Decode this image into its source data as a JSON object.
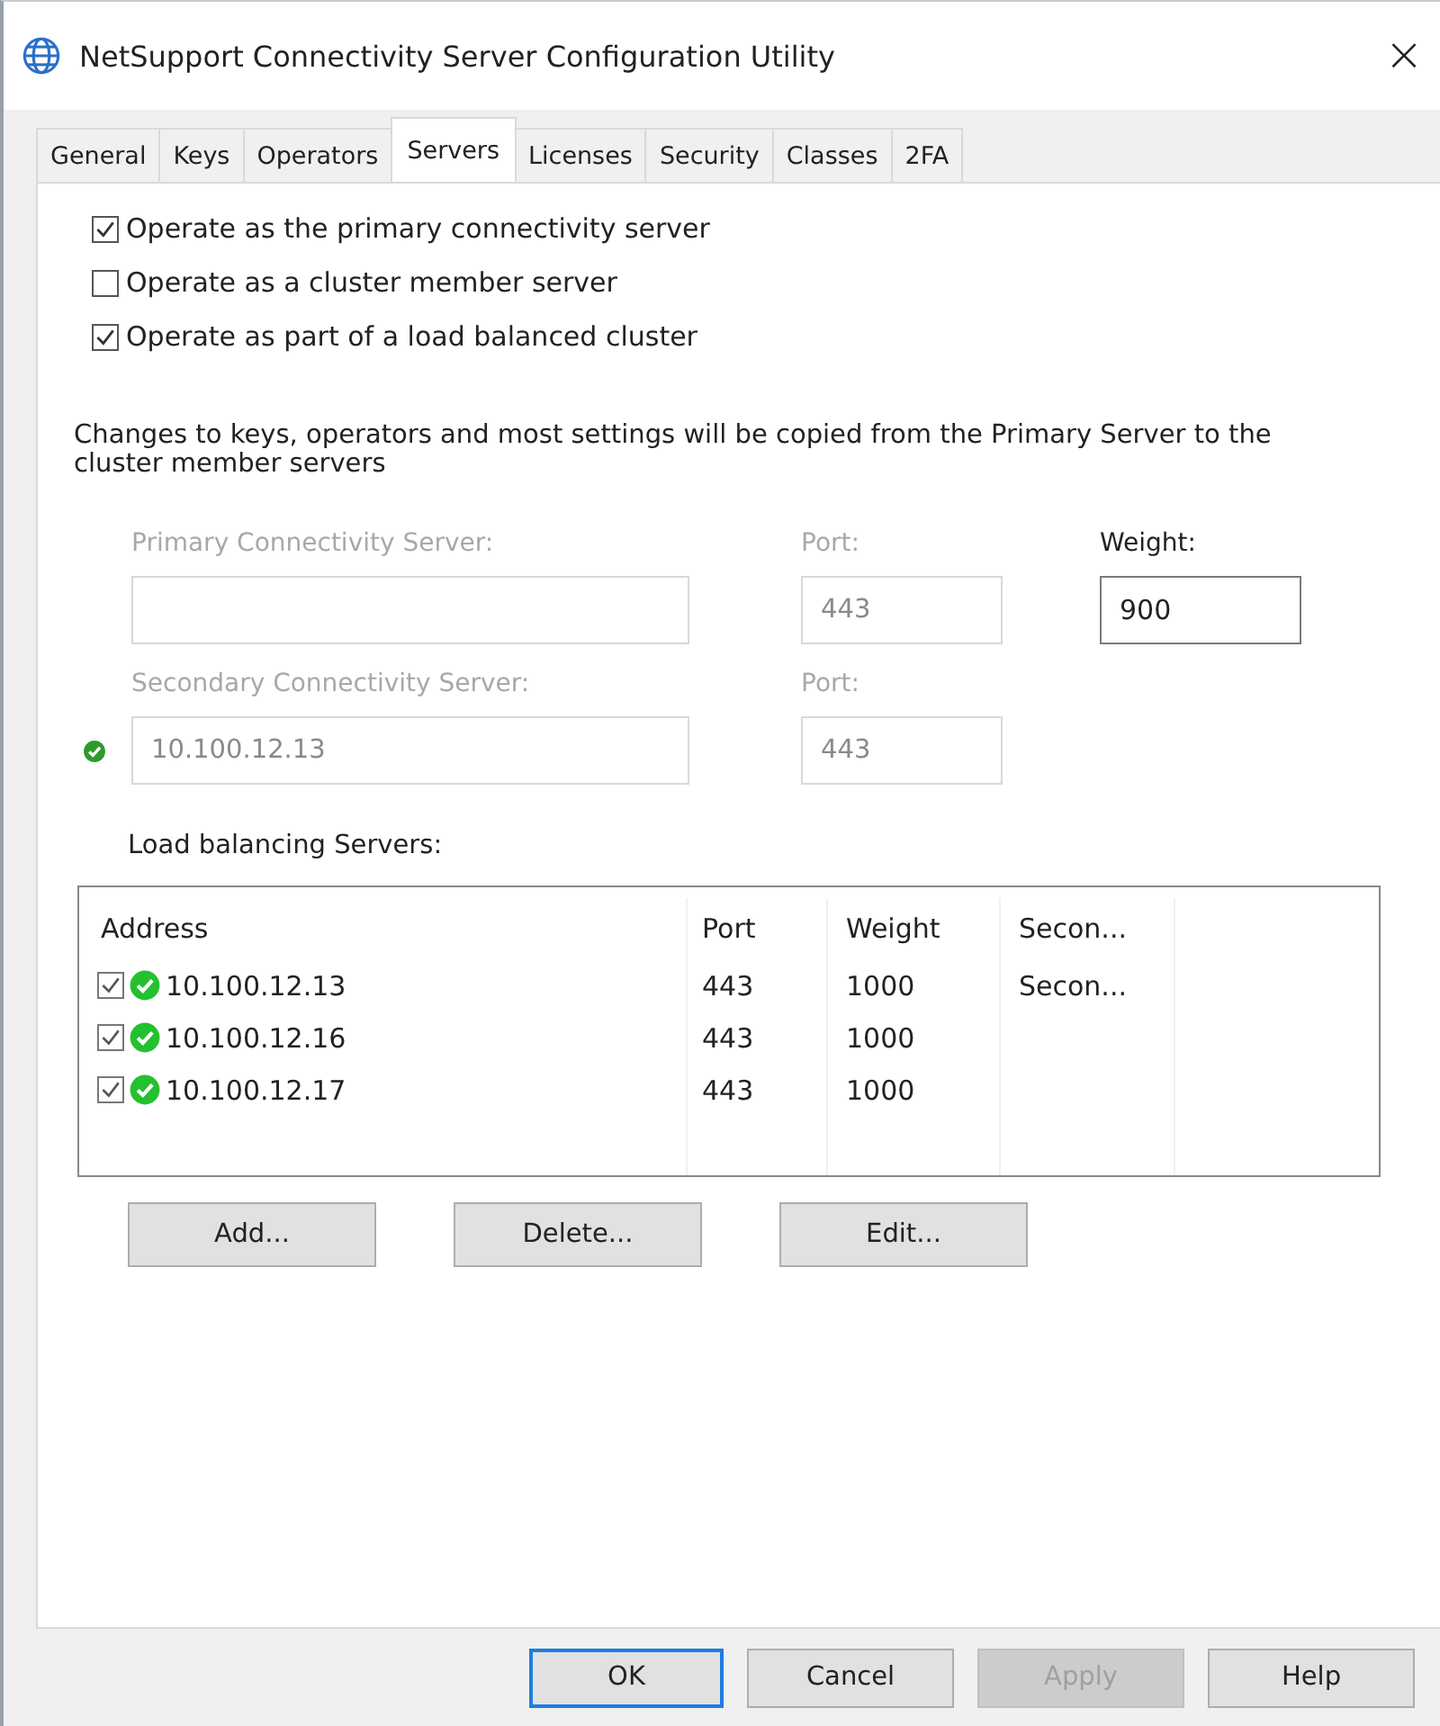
{
  "window": {
    "title": "NetSupport Connectivity Server Configuration Utility",
    "close": "×"
  },
  "tabs": [
    {
      "label": "General",
      "selected": false
    },
    {
      "label": "Keys",
      "selected": false
    },
    {
      "label": "Operators",
      "selected": false
    },
    {
      "label": "Servers",
      "selected": true
    },
    {
      "label": "Licenses",
      "selected": false
    },
    {
      "label": "Security",
      "selected": false
    },
    {
      "label": "Classes",
      "selected": false
    },
    {
      "label": "2FA",
      "selected": false
    }
  ],
  "options": [
    {
      "label": "Operate as the primary connectivity server",
      "checked": true
    },
    {
      "label": "Operate as a cluster member server",
      "checked": false
    },
    {
      "label": "Operate as part of a load balanced cluster",
      "checked": true
    }
  ],
  "note": "Changes to keys, operators and most settings will be copied from the Primary Server to the cluster member servers",
  "fields": [
    {
      "label": "Primary Connectivity Server:",
      "disabled": true,
      "status_ok": false,
      "port_label": "Port:",
      "port": "443",
      "port_disabled": true,
      "weight_label": "Weight:",
      "weight": "900"
    },
    {
      "label": "Secondary Connectivity Server:",
      "value": "10.100.12.13",
      "disabled": true,
      "status_ok": true,
      "port_label": "Port:",
      "port": "443",
      "port_disabled": true
    }
  ],
  "list": {
    "label": "Load balancing Servers:",
    "columns": [
      "Address",
      "Port",
      "Weight",
      "Secon..."
    ],
    "rows": [
      {
        "checked": true,
        "status_ok": true,
        "address": "10.100.12.13",
        "port": "443",
        "weight": "1000",
        "secondary": "Secon..."
      },
      {
        "checked": true,
        "status_ok": true,
        "address": "10.100.12.16",
        "port": "443",
        "weight": "1000"
      },
      {
        "checked": true,
        "status_ok": true,
        "address": "10.100.12.17",
        "port": "443",
        "weight": "1000"
      }
    ]
  },
  "list_buttons": [
    "Add...",
    "Delete...",
    "Edit..."
  ],
  "dialog_buttons": [
    {
      "label": "OK",
      "default": true,
      "disabled": false
    },
    {
      "label": "Cancel",
      "default": false,
      "disabled": false
    },
    {
      "label": "Apply",
      "default": false,
      "disabled": true
    },
    {
      "label": "Help",
      "default": false,
      "disabled": false
    }
  ]
}
